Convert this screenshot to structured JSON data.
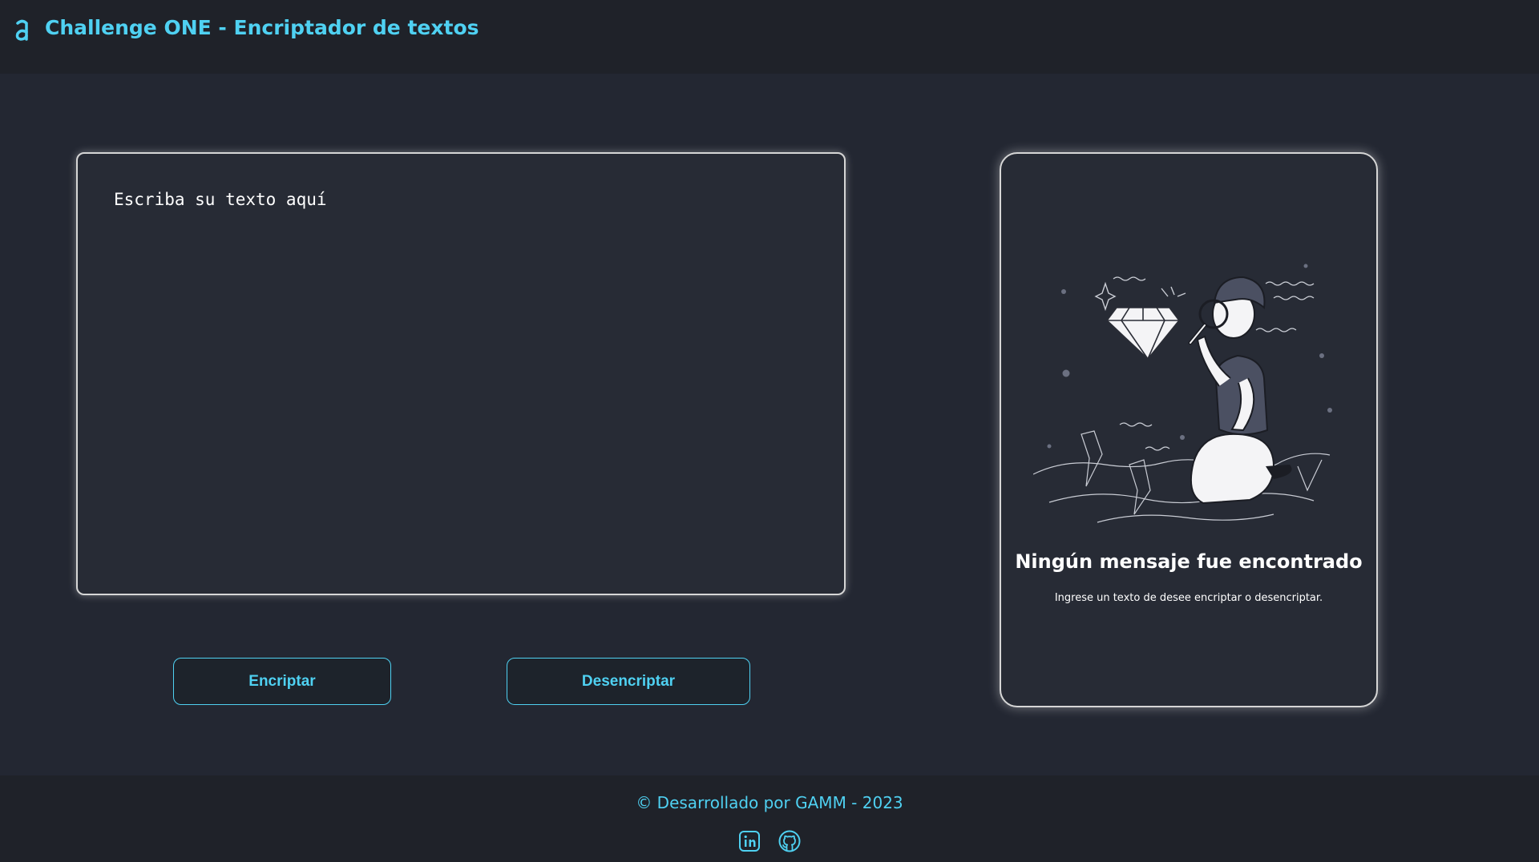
{
  "header": {
    "title": "Challenge ONE - Encriptador de textos",
    "logo_icon": "alura-logo-icon"
  },
  "input": {
    "placeholder": "Escriba su texto aquí",
    "value": ""
  },
  "buttons": {
    "encrypt_label": "Encriptar",
    "decrypt_label": "Desencriptar"
  },
  "output": {
    "illustration": "person-with-magnifier-and-diamond-illustration",
    "title": "Ningún mensaje fue encontrado",
    "subtitle": "Ingrese un texto de desee encriptar o desencriptar."
  },
  "footer": {
    "text": "© Desarrollado por GAMM - 2023",
    "links": [
      {
        "icon": "linkedin-icon"
      },
      {
        "icon": "github-icon"
      }
    ]
  },
  "colors": {
    "background": "#232732",
    "header_footer": "#1f2229",
    "accent": "#4fd1f2",
    "card": "#272b35",
    "card_border": "#d6d6d6"
  }
}
